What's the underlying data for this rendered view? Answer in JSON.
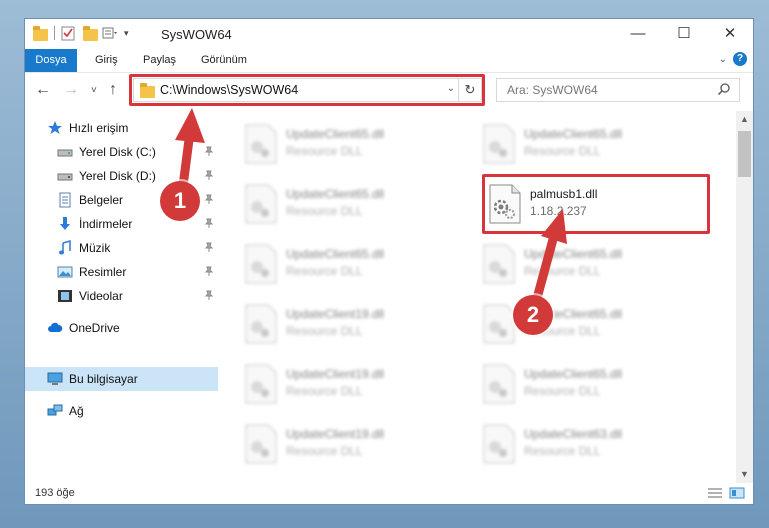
{
  "window": {
    "title": "SysWOW64",
    "controls": {
      "minimize": "—",
      "maximize": "☐",
      "close": "✕"
    }
  },
  "ribbon": {
    "tabs": [
      "Dosya",
      "Giriş",
      "Paylaş",
      "Görünüm"
    ]
  },
  "address": {
    "path": "C:\\Windows\\SysWOW64",
    "search_placeholder": "Ara: SysWOW64"
  },
  "sidebar": {
    "items": [
      {
        "label": "Hızlı erişim",
        "icon": "star-icon",
        "pinned": false
      },
      {
        "label": "Yerel Disk (C:)",
        "icon": "drive-icon",
        "pinned": true
      },
      {
        "label": "Yerel Disk (D:)",
        "icon": "drive-icon",
        "pinned": true
      },
      {
        "label": "Belgeler",
        "icon": "documents-icon",
        "pinned": true
      },
      {
        "label": "İndirmeler",
        "icon": "download-icon",
        "pinned": true
      },
      {
        "label": "Müzik",
        "icon": "music-icon",
        "pinned": true
      },
      {
        "label": "Resimler",
        "icon": "pictures-icon",
        "pinned": true
      },
      {
        "label": "Videolar",
        "icon": "videos-icon",
        "pinned": true
      },
      {
        "label": "OneDrive",
        "icon": "cloud-icon",
        "pinned": false
      },
      {
        "label": "Bu bilgisayar",
        "icon": "computer-icon",
        "pinned": false,
        "selected": true
      },
      {
        "label": "Ağ",
        "icon": "network-icon",
        "pinned": false
      }
    ]
  },
  "files": {
    "left_column": [
      {
        "name": "UpdateClient65.dll",
        "sub": "Resource DLL"
      },
      {
        "name": "UpdateClient65.dll",
        "sub": "Resource DLL"
      },
      {
        "name": "UpdateClient65.dll",
        "sub": "Resource DLL"
      },
      {
        "name": "UpdateClient19.dll",
        "sub": "Resource DLL"
      },
      {
        "name": "UpdateClient19.dll",
        "sub": "Resource DLL"
      },
      {
        "name": "UpdateClient19.dll",
        "sub": "Resource DLL"
      }
    ],
    "right_column": [
      {
        "name": "UpdateClient65.dll",
        "sub": "Resource DLL"
      },
      {
        "name": "palmusb1.dll",
        "sub": "1.18.2.237",
        "focused": true
      },
      {
        "name": "UpdateClient65.dll",
        "sub": "Resource DLL"
      },
      {
        "name": "UpdateClient65.dll",
        "sub": "Resource DLL"
      },
      {
        "name": "UpdateClient65.dll",
        "sub": "Resource DLL"
      },
      {
        "name": "UpdateClient63.dll",
        "sub": "Resource DLL"
      }
    ]
  },
  "status": {
    "count": "193 öğe"
  },
  "callouts": [
    "1",
    "2"
  ],
  "colors": {
    "accent": "#1979ca",
    "highlight": "#d9343b",
    "callout": "#d23a3a",
    "selected": "#cce4f7"
  }
}
